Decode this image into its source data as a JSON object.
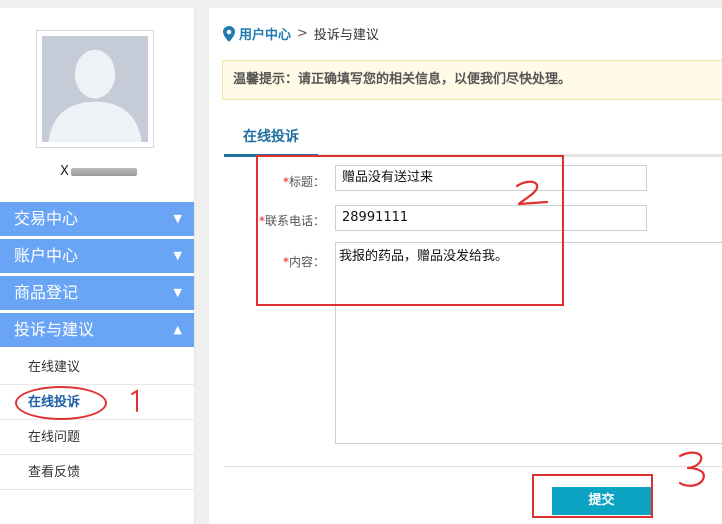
{
  "sidebar": {
    "username": "X",
    "menu": [
      {
        "label": "交易中心",
        "chevron": "chevron-down"
      },
      {
        "label": "账户中心",
        "chevron": "chevron-down"
      },
      {
        "label": "商品登记",
        "chevron": "chevron-down"
      },
      {
        "label": "投诉与建议",
        "chevron": "chevron-up"
      }
    ],
    "submenu": [
      {
        "label": "在线建议"
      },
      {
        "label": "在线投诉"
      },
      {
        "label": "在线问题"
      },
      {
        "label": "查看反馈"
      }
    ]
  },
  "breadcrumb": {
    "root": "用户中心",
    "separator": ">",
    "current": "投诉与建议"
  },
  "notice": "温馨提示：请正确填写您的相关信息，以便我们尽快处理。",
  "tab": {
    "label": "在线投诉"
  },
  "form": {
    "title": {
      "required_mark": "*",
      "label": "标题：",
      "value": "赠品没有送过来"
    },
    "phone": {
      "required_mark": "*",
      "label": "联系电话：",
      "value": "28991111"
    },
    "content": {
      "required_mark": "*",
      "label": "内容：",
      "value": "我报的药品，赠品没发给我。"
    }
  },
  "submit_label": "提交",
  "colors": {
    "menu_bg": "#6aa5f5",
    "accent": "#1f6fa0",
    "submit": "#0ca4c2",
    "annotation": "#e03030"
  }
}
